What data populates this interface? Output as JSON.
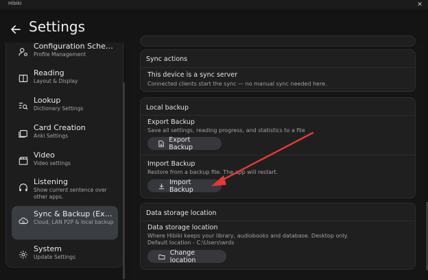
{
  "window": {
    "title": "Hibiki",
    "close_glyph": "✕"
  },
  "header": {
    "title": "Settings"
  },
  "sidebar": {
    "items": [
      {
        "label": "Configuration Sche…",
        "sub": "Profile Management",
        "icon": "user-gear-icon"
      },
      {
        "label": "Reading",
        "sub": "Layout & Display",
        "icon": "book-icon"
      },
      {
        "label": "Lookup",
        "sub": "Dictionary Settings",
        "icon": "search-list-icon"
      },
      {
        "label": "Card Creation",
        "sub": "Anki Settings",
        "icon": "cards-icon"
      },
      {
        "label": "Video",
        "sub": "Video settings",
        "icon": "clapperboard-icon"
      },
      {
        "label": "Listening",
        "sub": "Show current sentence over other apps.",
        "icon": "headphones-icon"
      },
      {
        "label": "Sync & Backup (Ex…",
        "sub": "Cloud, LAN P2P & local backup",
        "icon": "cloud-sync-icon",
        "active": true
      },
      {
        "label": "System",
        "sub": "Update Settings",
        "icon": "system-gear-icon"
      }
    ]
  },
  "sync_actions": {
    "heading": "Sync actions",
    "title": "This device is a sync server",
    "desc": "Connected clients start the sync — no manual sync needed here."
  },
  "local_backup": {
    "heading": "Local backup",
    "export": {
      "title": "Export Backup",
      "desc": "Save all settings, reading progress, and statistics to a file",
      "button": "Export Backup"
    },
    "import": {
      "title": "Import Backup",
      "desc": "Restore from a backup file. The app will restart.",
      "button": "Import Backup"
    }
  },
  "data_storage": {
    "heading": "Data storage location",
    "title": "Data storage location",
    "desc1": "Where Hibiki keeps your library, audiobooks and database. Desktop only.",
    "desc2": "Default location - C:\\Users\\wrds",
    "button": "Change location"
  },
  "annotation": {
    "color": "#e53935"
  }
}
